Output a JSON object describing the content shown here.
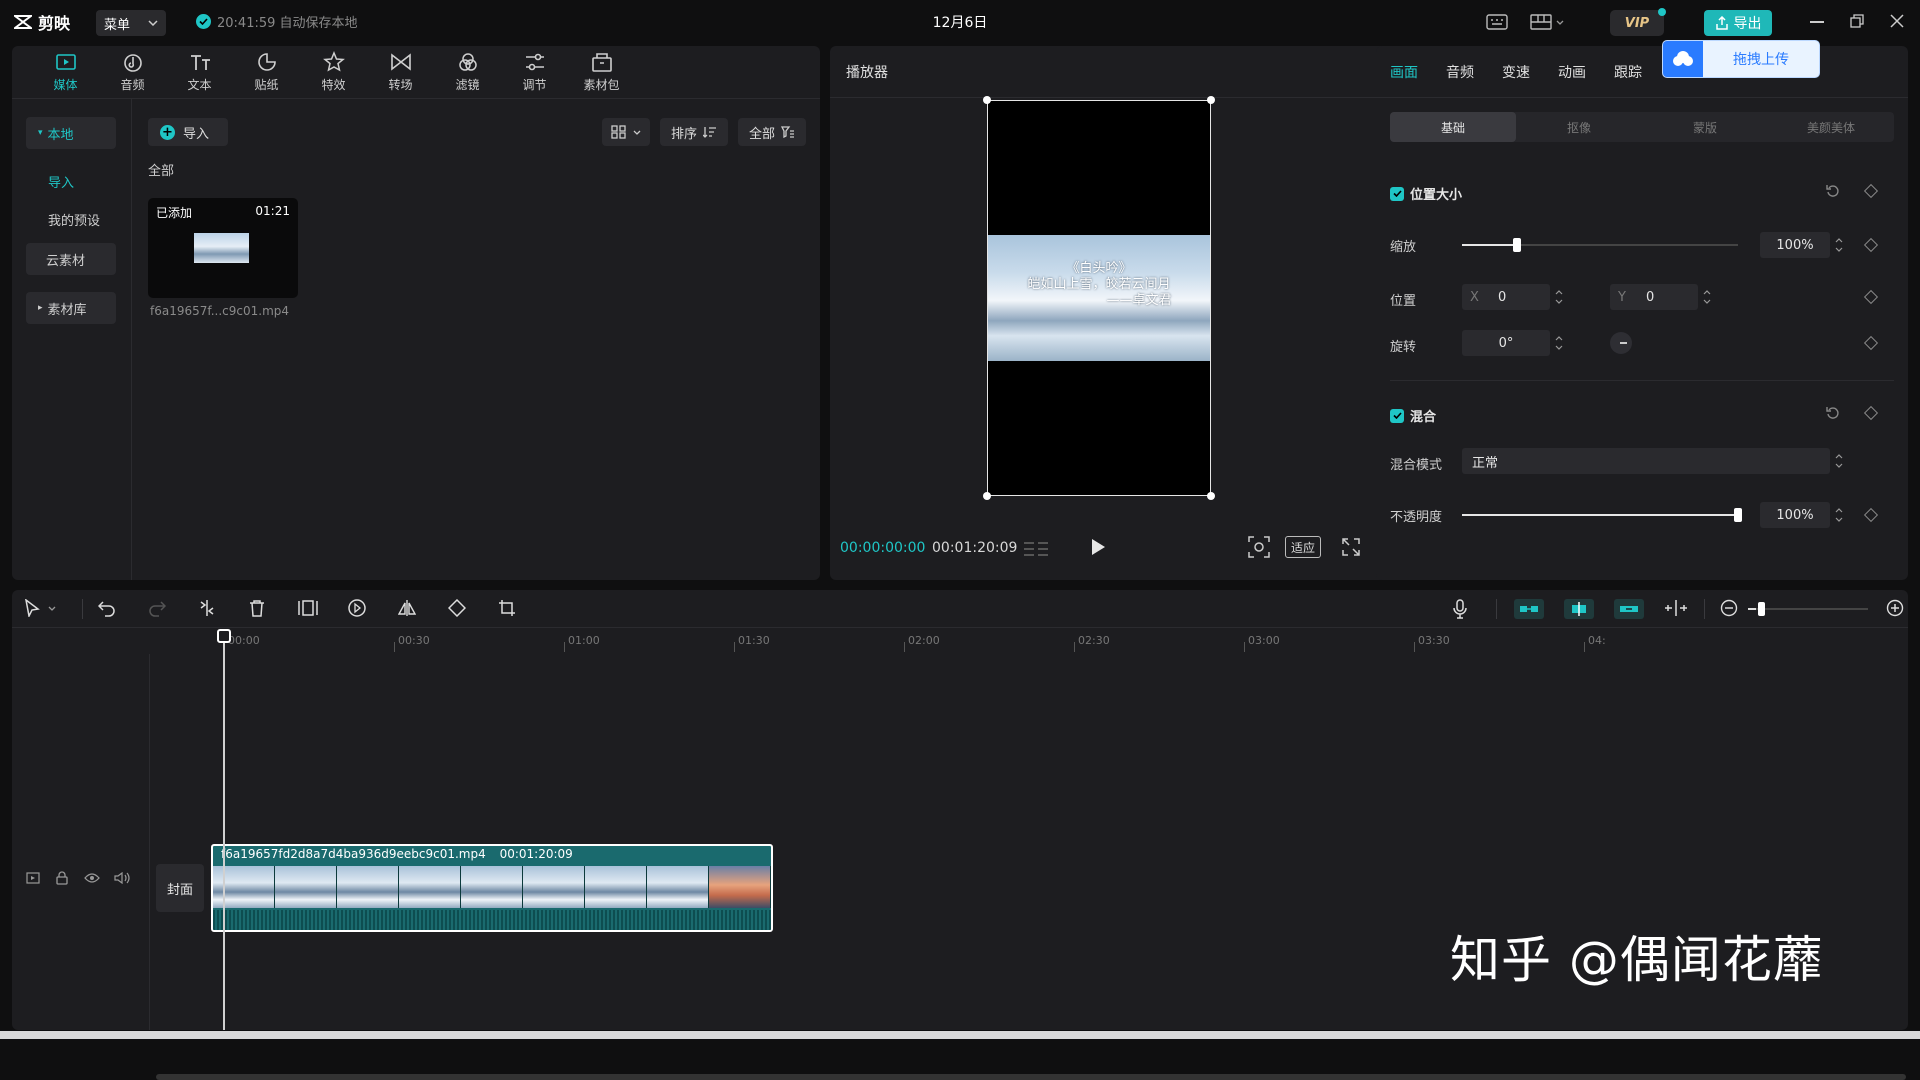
{
  "app": {
    "logo": "剪映",
    "menu": "菜单",
    "autosave": "20:41:59 自动保存本地",
    "doc_title": "12月6日",
    "vip": "VIP",
    "export": "导出",
    "drag_upload": "拖拽上传"
  },
  "media_tools": [
    {
      "label": "媒体",
      "icon": "media-icon",
      "active": true
    },
    {
      "label": "音频",
      "icon": "audio-icon"
    },
    {
      "label": "文本",
      "icon": "text-icon"
    },
    {
      "label": "贴纸",
      "icon": "sticker-icon"
    },
    {
      "label": "特效",
      "icon": "effects-icon"
    },
    {
      "label": "转场",
      "icon": "transition-icon"
    },
    {
      "label": "滤镜",
      "icon": "filter-icon"
    },
    {
      "label": "调节",
      "icon": "adjust-icon"
    },
    {
      "label": "素材包",
      "icon": "material-pack-icon"
    }
  ],
  "media_sidebar": {
    "local": "本地",
    "import": "导入",
    "presets": "我的预设",
    "cloud": "云素材",
    "library": "素材库"
  },
  "media_main": {
    "import_btn": "导入",
    "sort": "排序",
    "filter_all": "全部",
    "all_label": "全部",
    "clip": {
      "status": "已添加",
      "duration": "01:21",
      "name": "f6a19657f...c9c01.mp4"
    }
  },
  "player": {
    "title": "播放器",
    "current_time": "00:00:00:00",
    "total_time": "00:01:20:09",
    "fit": "适应",
    "poem": [
      "《白头吟》",
      "皑如山上雪，皎若云间月",
      "——卓文君"
    ]
  },
  "props": {
    "tabs": [
      "画面",
      "音频",
      "变速",
      "动画",
      "跟踪"
    ],
    "sub_tabs": [
      "基础",
      "抠像",
      "蒙版",
      "美颜美体"
    ],
    "position_size": {
      "title": "位置大小",
      "scale_label": "缩放",
      "scale_value": "100%",
      "scale_fraction": 0.2,
      "pos_label": "位置",
      "x_label": "X",
      "x_value": "0",
      "y_label": "Y",
      "y_value": "0",
      "rotate_label": "旋转",
      "rotate_value": "0°"
    },
    "blend": {
      "title": "混合",
      "mode_label": "混合模式",
      "mode_value": "正常",
      "opacity_label": "不透明度",
      "opacity_value": "100%",
      "opacity_fraction": 1.0
    }
  },
  "timeline": {
    "ticks": [
      "00:00",
      "00:30",
      "01:00",
      "01:30",
      "02:00",
      "02:30",
      "03:00",
      "03:30",
      "04:"
    ],
    "cover": "封面",
    "clip_name": "f6a19657fd2d8a7d4ba936d9eebc9c01.mp4",
    "clip_duration": "00:01:20:09"
  },
  "watermark": "知乎 @偶闻花蘼"
}
